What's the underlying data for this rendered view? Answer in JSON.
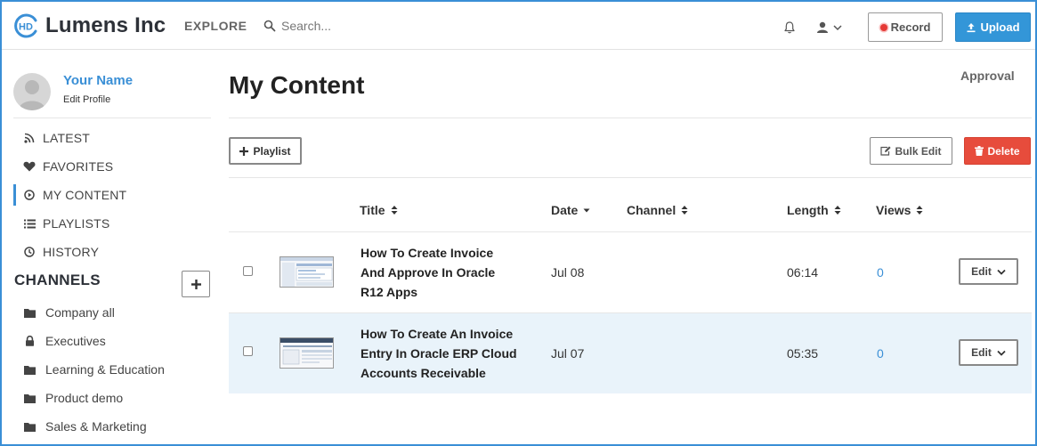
{
  "header": {
    "brand": "Lumens Inc",
    "logo_text": "HD",
    "explore_label": "EXPLORE",
    "search_placeholder": "Search...",
    "record_label": "Record",
    "upload_label": "Upload"
  },
  "profile": {
    "name": "Your Name",
    "edit_label": "Edit Profile"
  },
  "nav": {
    "items": [
      {
        "label": "LATEST",
        "icon": "rss-icon"
      },
      {
        "label": "FAVORITES",
        "icon": "heart-icon"
      },
      {
        "label": "MY CONTENT",
        "icon": "play-circle-icon",
        "active": true
      },
      {
        "label": "PLAYLISTS",
        "icon": "list-icon"
      },
      {
        "label": "HISTORY",
        "icon": "clock-icon"
      }
    ]
  },
  "channels": {
    "title": "CHANNELS",
    "items": [
      {
        "label": "Company all",
        "icon": "folder-icon"
      },
      {
        "label": "Executives",
        "icon": "lock-icon"
      },
      {
        "label": "Learning & Education",
        "icon": "folder-icon"
      },
      {
        "label": "Product demo",
        "icon": "folder-icon"
      },
      {
        "label": "Sales & Marketing",
        "icon": "folder-icon"
      }
    ]
  },
  "main": {
    "title": "My Content",
    "approval_label": "Approval",
    "playlist_label": "Playlist",
    "bulk_edit_label": "Bulk Edit",
    "delete_label": "Delete"
  },
  "table": {
    "headers": {
      "title": "Title",
      "date": "Date",
      "channel": "Channel",
      "length": "Length",
      "views": "Views"
    },
    "rows": [
      {
        "title_lines": [
          "How To Create Invoice",
          "And Approve In Oracle",
          "R12 Apps"
        ],
        "date": "Jul 08",
        "channel": "",
        "length": "06:14",
        "views": "0",
        "edit_label": "Edit"
      },
      {
        "title_lines": [
          "How To Create An Invoice",
          "Entry In Oracle ERP Cloud",
          "Accounts Receivable"
        ],
        "date": "Jul 07",
        "channel": "",
        "length": "05:35",
        "views": "0",
        "edit_label": "Edit"
      }
    ]
  },
  "colors": {
    "accent": "#3a8fd6",
    "upload_bg": "#3396d8",
    "delete_bg": "#e74c3c",
    "selected_row_bg": "#e9f3fa"
  }
}
